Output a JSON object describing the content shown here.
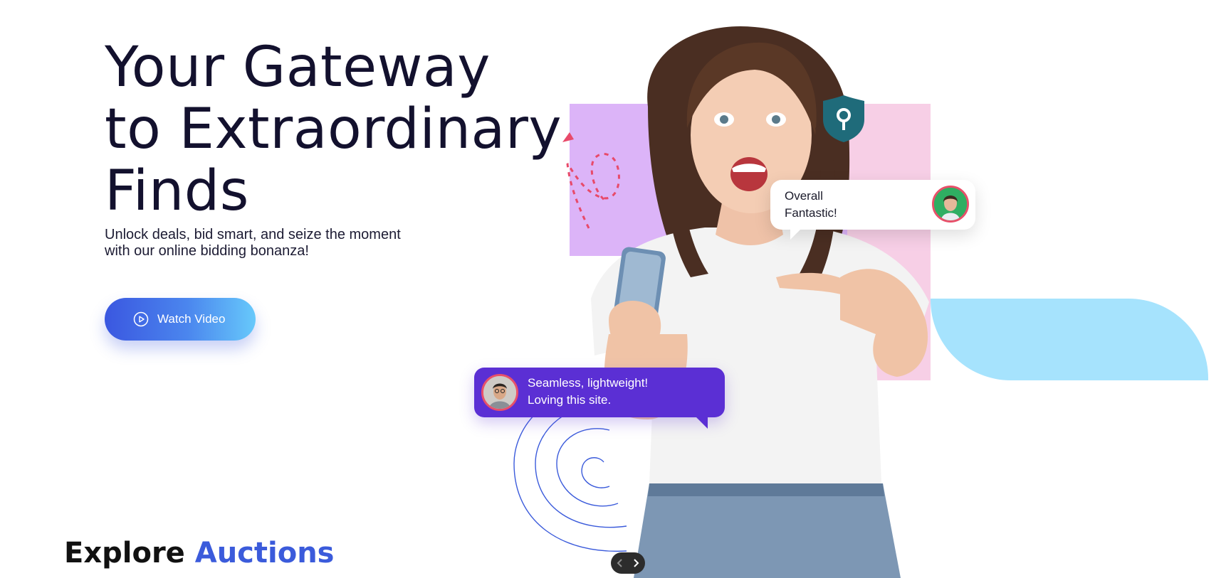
{
  "hero": {
    "title_lines": [
      "Your Gateway",
      "to Extraordinary",
      "Finds"
    ],
    "subtitle_lines": [
      "Unlock deals, bid smart, and seize the moment",
      "with our online bidding bonanza!"
    ],
    "cta_label": "Watch Video"
  },
  "testimonials": [
    {
      "lines": [
        "Overall",
        "Fantastic!"
      ]
    },
    {
      "lines": [
        "Seamless, lightweight!",
        "Loving this site."
      ]
    }
  ],
  "section": {
    "title_plain": "Explore",
    "title_accent": "Auctions"
  },
  "icons": {
    "play": "play-circle-icon",
    "pin": "location-pin-shield-icon",
    "prev": "chevron-left-icon",
    "next": "chevron-right-icon"
  },
  "colors": {
    "primary": "#3b5bdb",
    "cta_gradient_end": "#67c9fb",
    "bubble_purple": "#5b2fd4",
    "shape_lilac": "#dcb4f8",
    "shape_pink": "#f7cfe6",
    "shape_sky": "#a6e3fd",
    "pin_teal": "#1f6b7a"
  }
}
